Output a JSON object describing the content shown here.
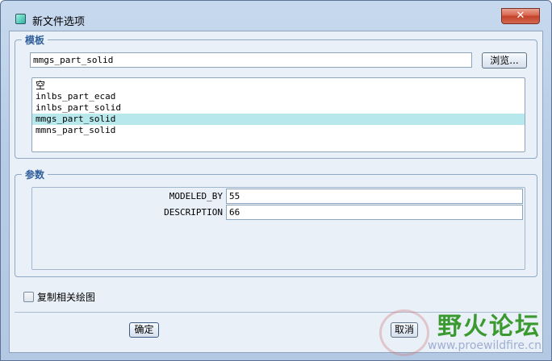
{
  "window": {
    "title": "新文件选项",
    "close_glyph": "✕"
  },
  "template_group": {
    "legend": "模板",
    "path_value": "mmgs_part_solid",
    "browse_label": "浏览...",
    "items": [
      {
        "label": "空",
        "selected": false
      },
      {
        "label": "inlbs_part_ecad",
        "selected": false
      },
      {
        "label": "inlbs_part_solid",
        "selected": false
      },
      {
        "label": "mmgs_part_solid",
        "selected": true
      },
      {
        "label": "mmns_part_solid",
        "selected": false
      }
    ]
  },
  "params_group": {
    "legend": "参数",
    "rows": [
      {
        "label": "MODELED_BY",
        "value": "55"
      },
      {
        "label": "DESCRIPTION",
        "value": "66"
      }
    ]
  },
  "copy_drawings": {
    "label": "复制相关绘图",
    "checked": false
  },
  "footer": {
    "ok_label": "确定",
    "cancel_label": "取消"
  },
  "watermark": {
    "title": "野火论坛",
    "url": "www.proewildfire.cn"
  },
  "colors": {
    "selection": "#b6e8ec",
    "legend": "#2f5f9c",
    "close_button": "#c3412a"
  }
}
